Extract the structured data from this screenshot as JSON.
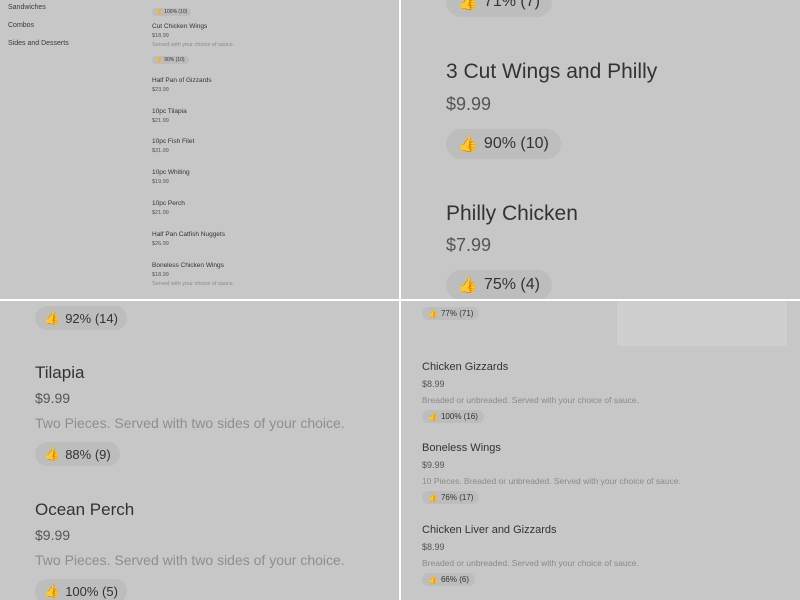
{
  "q1": {
    "categories": [
      "Sandwiches",
      "Combos",
      "Sides and Desserts"
    ],
    "top_rating": "100% (10)",
    "items": [
      {
        "name": "Cut Chicken Wings",
        "price": "$18.99",
        "desc": "Served with your choice of sauce.",
        "rating": "90% (10)"
      },
      {
        "name": "Half Pan of Gizzards",
        "price": "$23.99",
        "desc": "",
        "rating": ""
      },
      {
        "name": "10pc Tilapia",
        "price": "$21.99",
        "desc": "",
        "rating": ""
      },
      {
        "name": "10pc Fish Filet",
        "price": "$31.99",
        "desc": "",
        "rating": ""
      },
      {
        "name": "10pc Whiting",
        "price": "$19.99",
        "desc": "",
        "rating": ""
      },
      {
        "name": "10pc Perch",
        "price": "$21.99",
        "desc": "",
        "rating": ""
      },
      {
        "name": "Half Pan Catfish Nuggets",
        "price": "$26.99",
        "desc": "",
        "rating": ""
      },
      {
        "name": "Boneless Chicken Wings",
        "price": "$18.99",
        "desc": "Served with your choice of sauce.",
        "rating": ""
      }
    ]
  },
  "q2": {
    "top_rating": "71% (7)",
    "items": [
      {
        "name": "3 Cut Wings and Philly",
        "price": "$9.99",
        "rating": "90% (10)"
      },
      {
        "name": "Philly Chicken",
        "price": "$7.99",
        "rating": "75% (4)"
      }
    ]
  },
  "q3": {
    "top_rating": "92% (14)",
    "items": [
      {
        "name": "Tilapia",
        "price": "$9.99",
        "desc": "Two Pieces. Served with two sides of your choice.",
        "rating": "88% (9)"
      },
      {
        "name": "Ocean Perch",
        "price": "$9.99",
        "desc": "Two Pieces. Served with two sides of your choice.",
        "rating": "100% (5)"
      }
    ]
  },
  "q4": {
    "top_rating": "77% (71)",
    "items": [
      {
        "name": "Chicken Gizzards",
        "price": "$8.99",
        "desc": "Breaded or unbreaded. Served with your choice of sauce.",
        "rating": "100% (16)"
      },
      {
        "name": "Boneless Wings",
        "price": "$9.99",
        "desc": "10 Pieces. Breaded or unbreaded. Served with your choice of sauce.",
        "rating": "76% (17)"
      },
      {
        "name": "Chicken Liver and Gizzards",
        "price": "$8.99",
        "desc": "Breaded or unbreaded. Served with your choice of sauce.",
        "rating": "66% (6)"
      }
    ]
  },
  "icons": {
    "thumbs_up": "👍"
  }
}
